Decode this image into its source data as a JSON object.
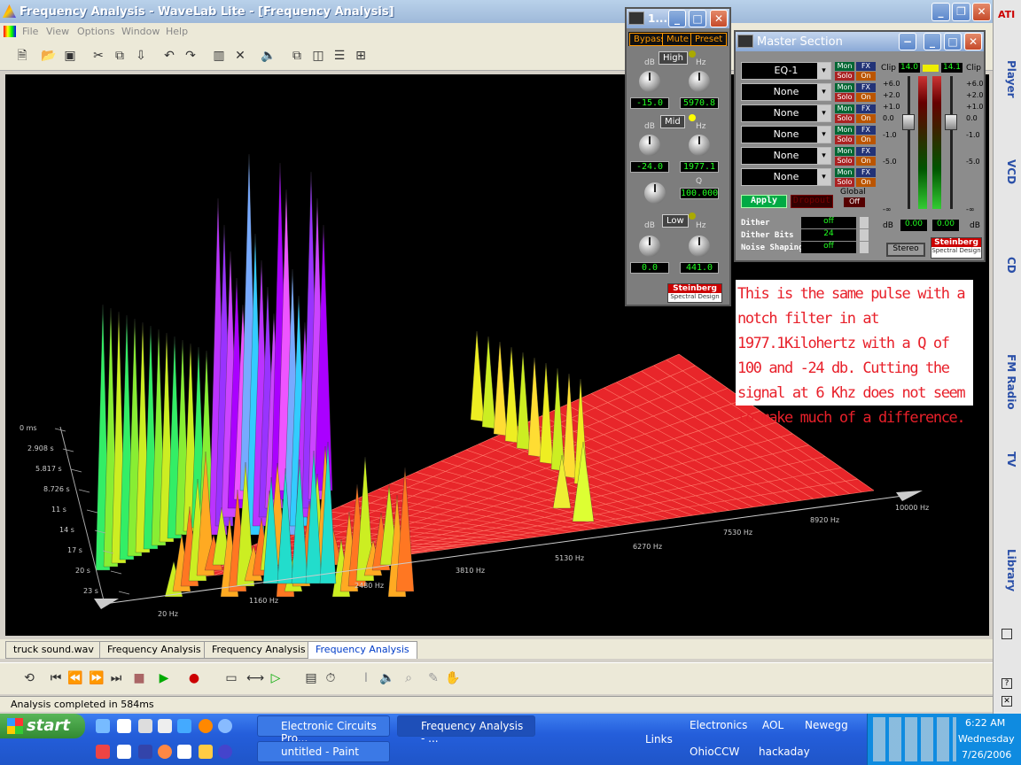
{
  "window": {
    "title": "Frequency Analysis - WaveLab Lite - [Frequency Analysis]",
    "ati": "ATI"
  },
  "menu": [
    "File",
    "View",
    "Options",
    "Window",
    "Help"
  ],
  "tabs": [
    "truck sound.wav",
    "Frequency Analysis",
    "Frequency Analysis",
    "Frequency Analysis"
  ],
  "status": "Analysis completed in 584ms",
  "plot": {
    "time_ticks": [
      "0 ms",
      "2.908 s",
      "5.817 s",
      "8.726 s",
      "11 s",
      "14 s",
      "17 s",
      "20 s",
      "23 s"
    ],
    "freq_ticks": [
      "20 Hz",
      "1160 Hz",
      "2480 Hz",
      "3810 Hz",
      "5130 Hz",
      "6270 Hz",
      "7530 Hz",
      "8920 Hz",
      "10000 Hz"
    ],
    "colors": {
      "floor": "#e8262a",
      "grid": "#ff6a5a"
    }
  },
  "eq": {
    "title": "1...",
    "buttons": [
      "Bypass",
      "Mute",
      "Preset"
    ],
    "high": {
      "label": "High",
      "db": "-15.0",
      "hz": "5970.8"
    },
    "mid": {
      "label": "Mid",
      "db": "-24.0",
      "hz": "1977.1",
      "q": "100.000"
    },
    "low": {
      "label": "Low",
      "db": "0.0",
      "hz": "441.0"
    },
    "unit_db": "dB",
    "unit_hz": "Hz",
    "unit_q": "Q",
    "brand": "Steinberg",
    "brand_sub": "Spectral Design"
  },
  "master": {
    "title": "Master Section",
    "slots": [
      "EQ-1",
      "None",
      "None",
      "None",
      "None",
      "None"
    ],
    "mon": "Mon",
    "solo": "Solo",
    "fx": "FX",
    "on": "On",
    "apply": "Apply",
    "dropout": "Dropout",
    "global": "Global",
    "global_val": "Off",
    "dither": {
      "label": "Dither",
      "value": "off"
    },
    "bits": {
      "label": "Dither Bits",
      "value": "24"
    },
    "noise": {
      "label": "Noise Shaping",
      "value": "off"
    },
    "clip": "Clip",
    "clip_l": "14.0",
    "clip_r": "14.1",
    "scale": [
      "+6.0",
      "+2.0",
      "+1.0",
      "0.0",
      "-1.0",
      "-5.0",
      "-∞"
    ],
    "out_l": "0.00",
    "out_r": "0.00",
    "db": "dB",
    "stereo": "Stereo",
    "brand": "Steinberg",
    "brand_sub": "Spectral Design"
  },
  "note": "This is the same pulse with a notch filter in at 1977.1Kilohertz with a Q of 100 and -24 db. Cutting the signal at 6 Khz does not seem to make much of a difference.",
  "sidebar": [
    "Player",
    "VCD",
    "CD",
    "FM Radio",
    "TV",
    "Library"
  ],
  "taskbar": {
    "start": "start",
    "tasks": [
      "Electronic Circuits Pro...",
      "Frequency Analysis - ...",
      "untitled - Paint"
    ],
    "links_label": "Links",
    "links": [
      "Electronics",
      "AOL",
      "Newegg",
      "OhioCCW",
      "hackaday"
    ],
    "time": "6:22 AM",
    "day": "Wednesday",
    "date": "7/26/2006"
  }
}
